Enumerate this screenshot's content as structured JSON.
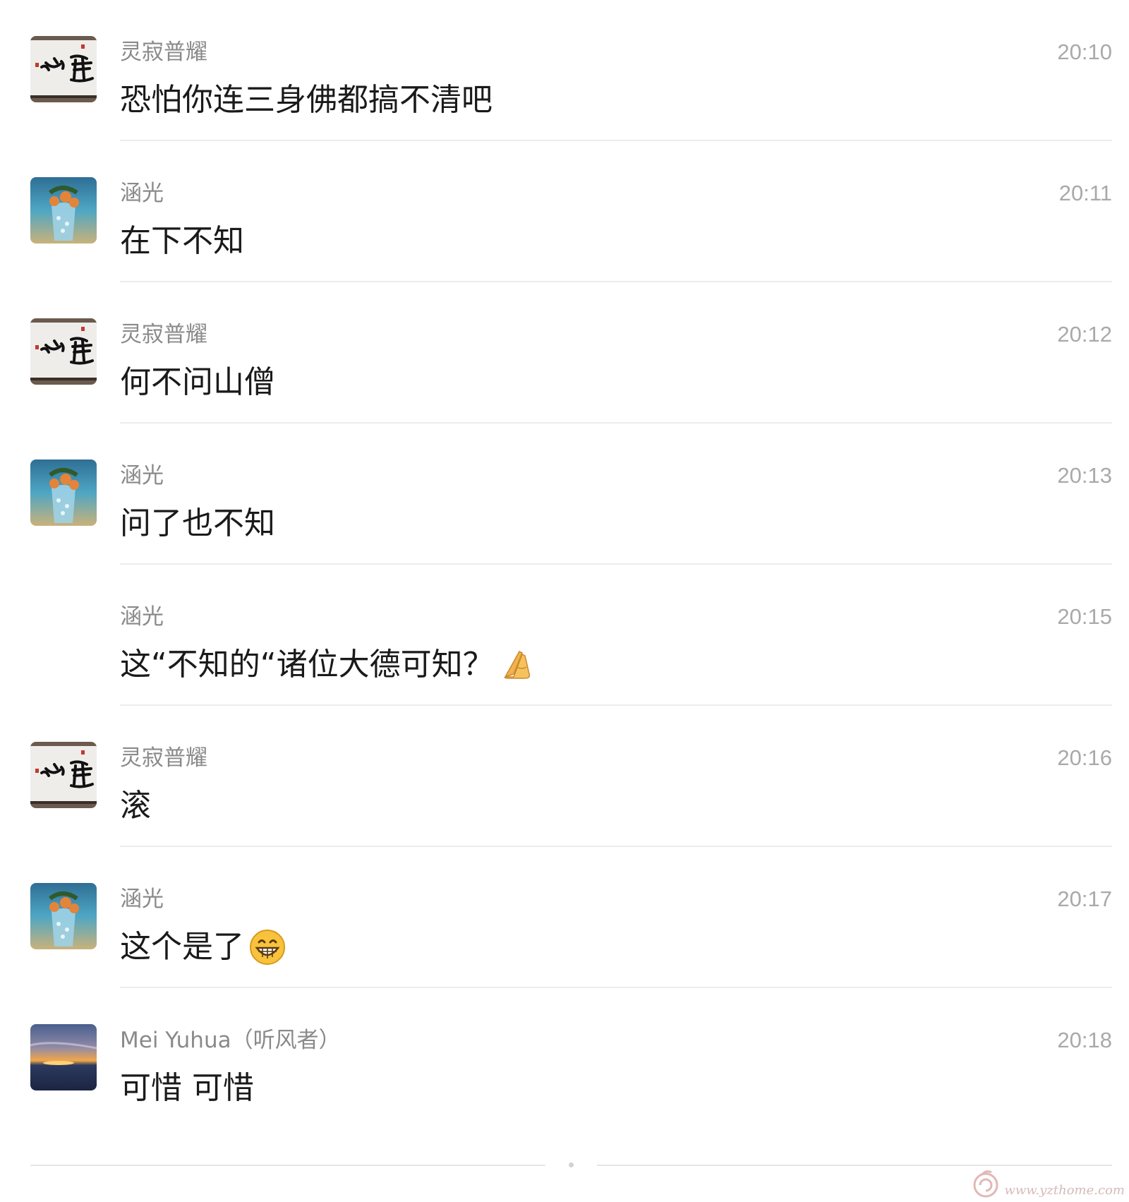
{
  "messages": [
    {
      "sender": "灵寂普耀",
      "time": "20:10",
      "text": "恐怕你连三身佛都搞不清吧",
      "avatar": "calligraphy-avatar",
      "emoji": null
    },
    {
      "sender": "涵光",
      "time": "20:11",
      "text": "在下不知",
      "avatar": "ocean-avatar",
      "emoji": null
    },
    {
      "sender": "灵寂普耀",
      "time": "20:12",
      "text": "何不问山僧",
      "avatar": "calligraphy-avatar",
      "emoji": null
    },
    {
      "sender": "涵光",
      "time": "20:13",
      "text": "问了也不知",
      "avatar": "ocean-avatar",
      "emoji": null
    },
    {
      "sender": "涵光",
      "time": "20:15",
      "text": "这“不知的“诸位大德可知？",
      "avatar": null,
      "emoji": "pray-hands-icon"
    },
    {
      "sender": "灵寂普耀",
      "time": "20:16",
      "text": "滚",
      "avatar": "calligraphy-avatar",
      "emoji": null
    },
    {
      "sender": "涵光",
      "time": "20:17",
      "text": "这个是了",
      "avatar": "ocean-avatar",
      "emoji": "grin-face-icon"
    },
    {
      "sender": "Mei Yuhua（听风者）",
      "time": "20:18",
      "text": "可惜 可惜",
      "avatar": "sunset-avatar",
      "emoji": null
    }
  ],
  "watermark": {
    "text": "www.yzthome.com"
  },
  "colors": {
    "sender": "#8a8a8a",
    "time": "#a9a9a9",
    "text": "#1a1a1a",
    "divider": "#ececec"
  }
}
